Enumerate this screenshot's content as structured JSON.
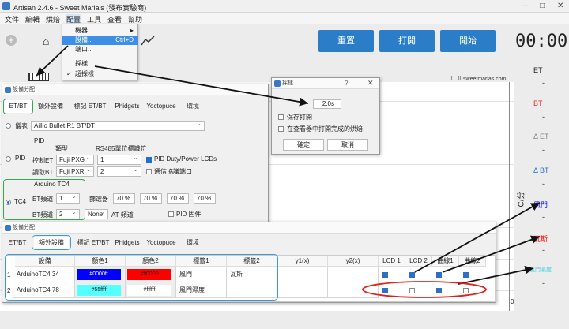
{
  "window": {
    "title": "Artisan 2.4.6 - Sweet Maria's (發布實驗商)",
    "controls": [
      "—",
      "□",
      "✕"
    ]
  },
  "menubar": [
    "文件",
    "編輯",
    "烘焙",
    "配置",
    "工具",
    "查看",
    "幫助"
  ],
  "config_menu": {
    "items": [
      {
        "label": "機器",
        "arrow": "▸"
      },
      {
        "label": "設備...",
        "shortcut": "Ctrl+D",
        "selected": true
      },
      {
        "label": "端口..."
      },
      {
        "label": "採樣..."
      },
      {
        "label": "超採樣",
        "checked": true
      }
    ]
  },
  "toolbar": {
    "reset": "重置",
    "open": "打開",
    "start": "開始",
    "timer": "00:00"
  },
  "watermark": "⠿...⠿ sweetmarias.com",
  "right_labels": {
    "et": "ET",
    "bt": "BT",
    "delta_et": "Δ ET",
    "delta_bt": "Δ BT",
    "fan": "風門",
    "gas": "瓦斯",
    "fan_humid": "風門濕度",
    "axis_c": "C/分",
    "axis_zero": "0"
  },
  "device_dialog_top": {
    "title": "設備分配",
    "tabs": [
      "ET/BT",
      "額外設備",
      "標記 ET/BT",
      "Phidgets",
      "Yoctopuce",
      "環境"
    ],
    "meter_label": "儀表",
    "meter_value": "Aillio Bullet R1 BT/DT",
    "pid_header": "PID",
    "pid_label": "PID",
    "type_col": "類型",
    "rs485_col": "RS485單位標識符",
    "ctrl_et": "控制ET",
    "read_bt": "讀取BT",
    "ctrl_type": "Fuji PXG",
    "read_type": "Fuji PXR",
    "ctrl_unit": "1",
    "read_unit": "2",
    "pid_duty": "PID Duty/Power LCDs",
    "comm_port": "通信協議端口",
    "tc4_section": "Arduino TC4",
    "tc4_label": "TC4",
    "et_channel_label": "ET頻道",
    "et_channel": "1",
    "bt_channel_label": "BT頻道",
    "bt_channel": "2",
    "filter_label": "篩選器",
    "filters": [
      "70 %",
      "70 %",
      "70 %",
      "70 %"
    ],
    "none_value": "None",
    "at_channel": "AT 頻道",
    "pid_firmware": "PID 固件"
  },
  "sampling_dialog": {
    "title": "採樣",
    "help": "?",
    "close": "✕",
    "interval": "2.0s",
    "keep_open": "保存打開",
    "open_completed": "在查看器中打開完成的烘焙",
    "ok": "確定",
    "cancel": "取消"
  },
  "device_dialog_bottom": {
    "title": "設備分配",
    "tabs": [
      "ET/BT",
      "額外設備",
      "標記 ET/BT",
      "Phidgets",
      "Yoctopuce",
      "環境"
    ],
    "columns": [
      "設備",
      "顏色1",
      "顏色2",
      "標籤1",
      "標籤2",
      "y1(x)",
      "y2(x)",
      "LCD 1",
      "LCD 2",
      "曲線1",
      "曲線2"
    ],
    "rows": [
      {
        "num": "1",
        "device": "ArduinoTC4 34",
        "color1": "#0000ff",
        "color2": "#ff0000",
        "label1": "風門",
        "label2": "瓦斯",
        "lcd1": true,
        "lcd2": true,
        "curve1": true,
        "curve2": true
      },
      {
        "num": "2",
        "device": "ArduinoTC4 78",
        "color1": "#55ffff",
        "color2": "#ffffff",
        "label1": "風門濕度",
        "label2": "",
        "lcd1": true,
        "lcd2": false,
        "curve1": true,
        "curve2": false
      }
    ]
  },
  "colors": {
    "accent": "#2b7dc7",
    "et": "#e03030",
    "bt": "#c00000",
    "fan": "#0000ff",
    "gas": "#ff0000",
    "humid": "#55ffff",
    "highlight_green": "#3aa64b",
    "highlight_blue": "#3a9ad8",
    "highlight_red": "#e02020"
  }
}
